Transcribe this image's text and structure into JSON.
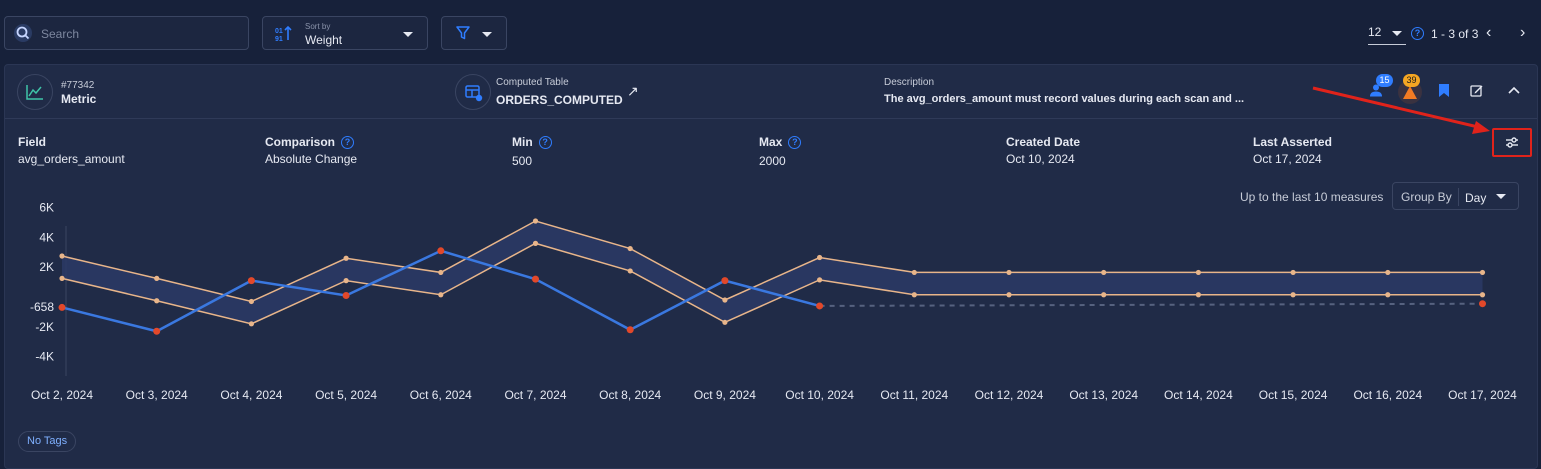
{
  "toolbar": {
    "search_placeholder": "Search",
    "sort_label": "Sort by",
    "sort_value": "Weight",
    "page_size": "12",
    "page_range": "1 - 3 of 3"
  },
  "rule": {
    "id": "#77342",
    "type": "Metric",
    "table_kind": "Computed Table",
    "table_name": "ORDERS_COMPUTED",
    "description_label": "Description",
    "description": "The avg_orders_amount must record values during each scan and ...",
    "user_badge": "15",
    "anomaly_badge": "39"
  },
  "fields": {
    "field_label": "Field",
    "field_value": "avg_orders_amount",
    "comparison_label": "Comparison",
    "comparison_value": "Absolute Change",
    "min_label": "Min",
    "min_value": "500",
    "max_label": "Max",
    "max_value": "2000",
    "created_label": "Created Date",
    "created_value": "Oct 10, 2024",
    "asserted_label": "Last Asserted",
    "asserted_value": "Oct 17, 2024"
  },
  "chart_controls": {
    "measures_text": "Up to the last 10 measures",
    "group_by_label": "Group By",
    "group_by_value": "Day"
  },
  "tags_label": "No Tags",
  "colors": {
    "background": "#17213a",
    "card": "#202b47",
    "accent_blue": "#2f7dff",
    "measured_line": "#3a78e0",
    "band_line": "#e8b58a",
    "anomaly_point": "#e2482a",
    "highlight_red": "#e0231b"
  },
  "chart_data": {
    "type": "line",
    "categories": [
      "Oct 2, 2024",
      "Oct 3, 2024",
      "Oct 4, 2024",
      "Oct 5, 2024",
      "Oct 6, 2024",
      "Oct 7, 2024",
      "Oct 8, 2024",
      "Oct 9, 2024",
      "Oct 10, 2024",
      "Oct 11, 2024",
      "Oct 12, 2024",
      "Oct 13, 2024",
      "Oct 14, 2024",
      "Oct 15, 2024",
      "Oct 16, 2024",
      "Oct 17, 2024"
    ],
    "y_ticks": [
      "6K",
      "4K",
      "2K",
      "-658",
      "-2K",
      "-4K"
    ],
    "y_tick_values": [
      6000,
      4000,
      2000,
      -658,
      -2000,
      -4000
    ],
    "ylim": [
      -4000,
      6000
    ],
    "grid": false,
    "series": [
      {
        "values": [
          -700,
          -2300,
          1100,
          100,
          3100,
          1200,
          -2200,
          1100,
          -600,
          null,
          null,
          null,
          null,
          null,
          null,
          -450
        ],
        "anomalies": [
          0,
          1,
          2,
          3,
          4,
          5,
          6,
          7,
          8,
          15
        ]
      },
      {
        "values": [
          2750,
          1250,
          -300,
          2600,
          1650,
          5100,
          3250,
          -200,
          2650,
          1650,
          1650,
          1650,
          1650,
          1650,
          1650,
          1650
        ]
      },
      {
        "values": [
          1250,
          -250,
          -1800,
          1100,
          150,
          3600,
          1750,
          -1700,
          1150,
          150,
          150,
          150,
          150,
          150,
          150,
          150
        ]
      }
    ]
  }
}
